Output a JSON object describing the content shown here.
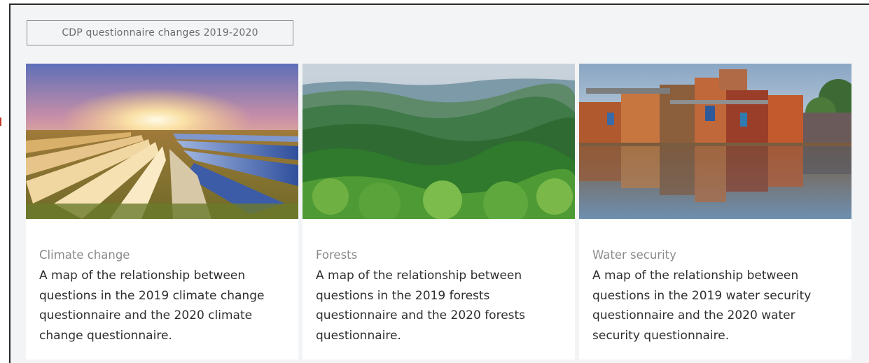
{
  "header": {
    "tab_label": "CDP questionnaire changes 2019-2020"
  },
  "accent_color": "#c0392b",
  "cards": [
    {
      "title": "Climate change",
      "description": "A map of the relationship between questions in the 2019 climate change questionnaire and the 2020 climate change questionnaire.",
      "image": "solar-panels-sunset"
    },
    {
      "title": "Forests",
      "description": "A map of the relationship between questions in the 2019 forests questionnaire and the 2020 forests questionnaire.",
      "image": "forest-hills"
    },
    {
      "title": "Water security",
      "description": "A map of the relationship between questions in the 2019 water security questionnaire and the 2020 water security questionnaire.",
      "image": "flooded-houses"
    }
  ]
}
